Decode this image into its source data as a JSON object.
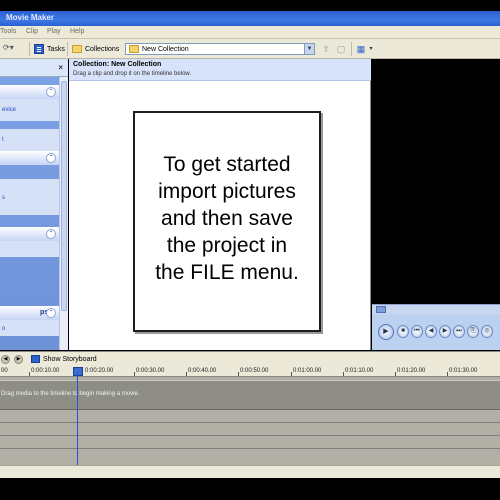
{
  "window": {
    "title": "Movie Maker"
  },
  "menubar": {
    "items": [
      "Tools",
      "Clip",
      "Play",
      "Help"
    ]
  },
  "toolbar": {
    "tasks_label": "Tasks",
    "collections_label": "Collections",
    "collection_select": "New Collection"
  },
  "tasks_pane": {
    "panels": [
      {
        "link": "evice"
      },
      {
        "link": "t"
      },
      {
        "link": "s"
      },
      {
        "link": ""
      },
      {
        "title": "ps",
        "link": "o"
      }
    ]
  },
  "collection": {
    "title": "Collection: New Collection",
    "subtitle": "Drag a clip and drop it on the timeline below."
  },
  "notice": {
    "lines": [
      "To get started",
      "import pictures",
      "and then save",
      "the project in",
      "the FILE menu."
    ]
  },
  "timeline": {
    "storyboard_label": "Show Storyboard",
    "ruler": [
      "00",
      "0:00:10.00",
      "0:00:20.00",
      "0:00:30.00",
      "0:00:40.00",
      "0:00:50.00",
      "0:01:00.00",
      "0:01:10.00",
      "0:01:20.00",
      "0:01:30.00"
    ],
    "hint": "Drag media to the timeline to begin making a movie."
  },
  "icons": {
    "tasks": "tasks-icon",
    "collections": "folder-icon",
    "close": "close-icon",
    "play": "play-icon"
  },
  "colors": {
    "accent": "#2f62c8",
    "timeline_playhead": "#1d57d1"
  }
}
